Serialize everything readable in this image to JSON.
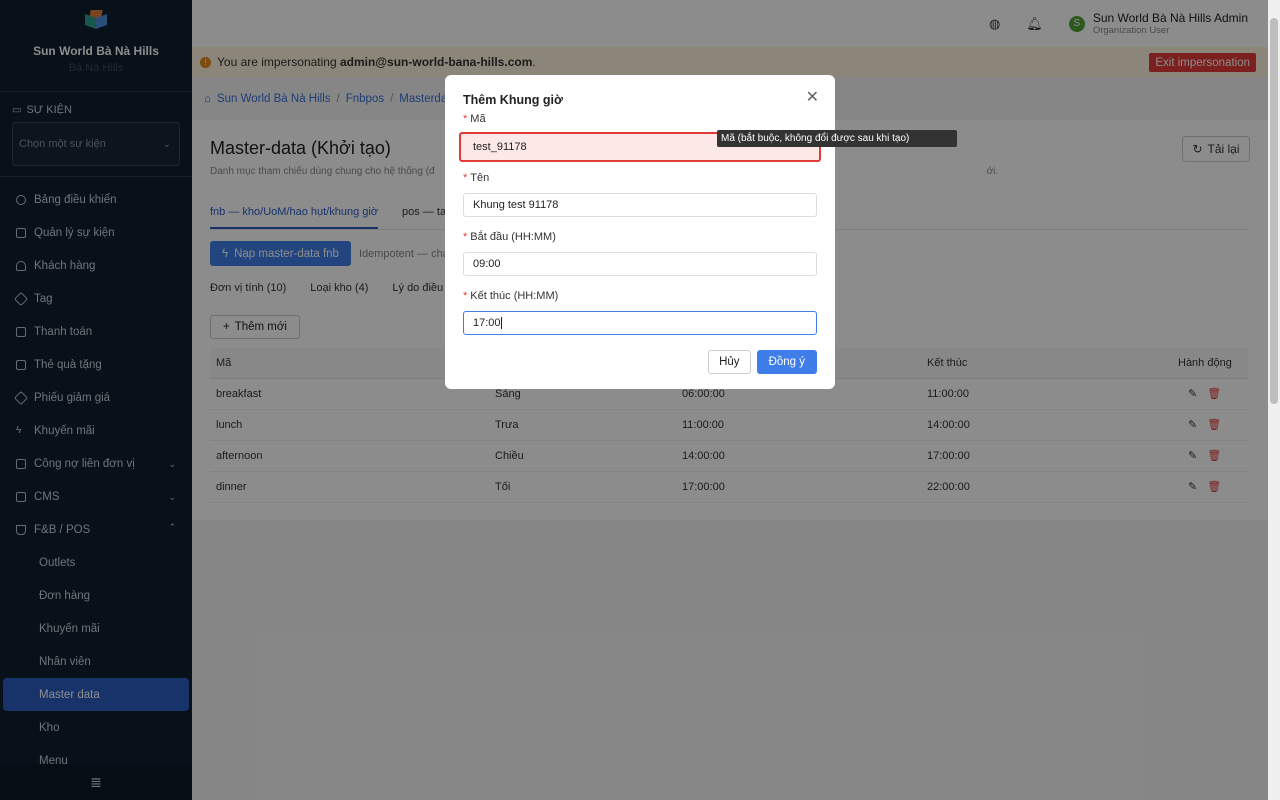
{
  "sidebar": {
    "brand_name": "Sun World Bà Nà Hills",
    "brand_sub": "Bà Nà Hills",
    "section_title": "SỰ KIỆN",
    "event_placeholder": "Chọn một sự kiện",
    "items": [
      {
        "label": "Bảng điều khiển",
        "icon": "dashboard-icon"
      },
      {
        "label": "Quản lý sự kiện",
        "icon": "calendar-icon"
      },
      {
        "label": "Khách hàng",
        "icon": "user-icon"
      },
      {
        "label": "Tag",
        "icon": "tag-icon"
      },
      {
        "label": "Thanh toán",
        "icon": "payment-icon"
      },
      {
        "label": "Thẻ quà tặng",
        "icon": "gift-icon"
      },
      {
        "label": "Phiếu giảm giá",
        "icon": "coupon-icon"
      },
      {
        "label": "Khuyến mãi",
        "icon": "lightning-icon"
      },
      {
        "label": "Công nợ liên đơn vị",
        "icon": "debt-icon"
      },
      {
        "label": "CMS",
        "icon": "cms-icon"
      },
      {
        "label": "F&B / POS",
        "icon": "fnb-icon"
      }
    ],
    "sub_items": [
      "Outlets",
      "Đơn hàng",
      "Khuyến mãi",
      "Nhân viên",
      "Master data",
      "Kho",
      "Menu"
    ],
    "active_sub": "Master data"
  },
  "topbar": {
    "user_name": "Sun World Bà Nà Hills Admin",
    "user_role": "Organization User",
    "avatar_letter": "S"
  },
  "impersonation": {
    "prefix": "You are impersonating ",
    "email": "admin@sun-world-bana-hills.com",
    "suffix": ".",
    "exit_label": "Exit impersonation"
  },
  "breadcrumb": [
    "Sun World Bà Nà Hills",
    "Fnbpos",
    "Masterdata"
  ],
  "page": {
    "title": "Master-data (Khởi tạo)",
    "description": "Danh mục tham chiếu dùng chung cho hệ thống (đ",
    "description_tail": "ới.",
    "reload_label": "Tải lại",
    "tabs": [
      "fnb — kho/UoM/hao hụt/khung giờ",
      "pos — tax"
    ],
    "load_button": "Nạp master-data fnb",
    "load_note": "Idempotent — chạy",
    "subtabs": [
      "Đơn vị tính (10)",
      "Loại kho (4)",
      "Lý do điều ch"
    ],
    "add_button": "Thêm mới"
  },
  "table": {
    "headers": [
      "Mã",
      "",
      "",
      "Kết thúc",
      "Hành động"
    ],
    "rows": [
      [
        "breakfast",
        "Sáng",
        "06:00:00",
        "11:00:00"
      ],
      [
        "lunch",
        "Trưa",
        "11:00:00",
        "14:00:00"
      ],
      [
        "afternoon",
        "Chiều",
        "14:00:00",
        "17:00:00"
      ],
      [
        "dinner",
        "Tối",
        "17:00:00",
        "22:00:00"
      ]
    ]
  },
  "modal": {
    "title": "Thêm Khung giờ",
    "fields": [
      {
        "label": "Mã",
        "value": "test_91178"
      },
      {
        "label": "Tên",
        "value": "Khung test 91178"
      },
      {
        "label": "Bắt đầu (HH:MM)",
        "value": "09:00"
      },
      {
        "label": "Kết thúc (HH:MM)",
        "value": "17:00"
      }
    ],
    "cancel_label": "Hủy",
    "ok_label": "Đồng ý",
    "tooltip": "Mã (bắt buộc, không đổi được sau khi tạo)"
  }
}
